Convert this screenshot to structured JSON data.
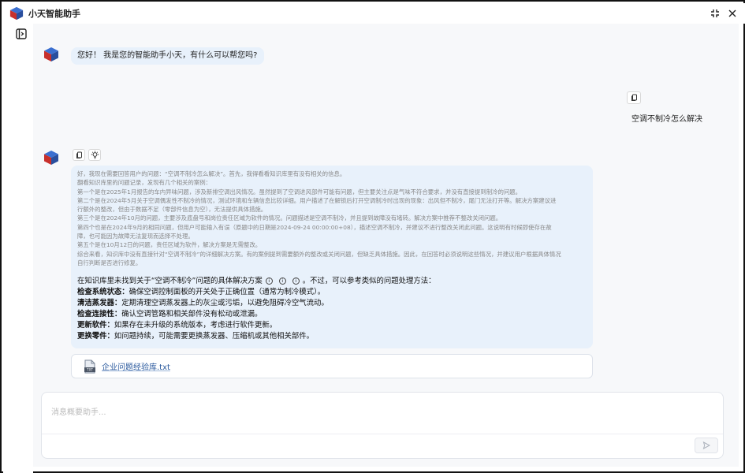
{
  "app": {
    "title": "小天智能助手"
  },
  "chat": {
    "greeting": "您好！ 我是您的智能助手小天，有什么可以帮您吗?",
    "user_message": "空调不制冷怎么解决",
    "thinking": [
      "好，我现在需要回答用户的问题：“空调不制冷怎么解决”。首先，我得看看知识库里有没有相关的信息。",
      "翻看知识库里的问题记录，发现有几个相关的案例：",
      "第一个是在2025年1月报告的车内异味问题，涉及新排空调出风情况。虽然提到了空调进风部件可能有问题，但主要关注点是气味不符合要求，并没有直接提到制冷的问题。",
      "第二个是在2024年5月关于空调偶发性不制冷的情况，测试环境和车辆信息比较详细。用户描述了在解锁后打开空调制冷时出现的现象：出风但不制冷，尾门无法打开等。解决方案建议进",
      "行额外的整改，但由于数据不足（零部件信息为空），无法提供具体措施。",
      "第三个是在2024年10月的问题，主要涉及底盘号和岗位责任区域为软件的情况。问题描述是空调不制冷，并且提到故障没有堵转。解决方案中推荐不整改关闭问题。",
      "第四个也是在2024年9月的相同问题，但用户可能输入有误（原题中的日期是2024-09-24 00:00:00+08），描述空调不制冷，并建议不进行整改关闭此问题。这说明有时候即使存在故",
      "障，也可能因为故障无法复现而选择不处理。",
      "第五个是在10月12日的问题，责任区域为软件，解决方案是无需整改。",
      "综合来看，知识库中没有直接针对“空调不制冷”的详细解决方案。有的案例提到需要额外的整改或关闭问题，但缺乏具体措施。因此，在回答时必须说明这些情况，并建议用户根据具体情况",
      "自行判断是否进行修复。"
    ],
    "answer_intro": "在知识库里未找到关于“空调不制冷”问题的具体解决方案",
    "answer_intro_tail": "。不过，可以参考类似的问题处理方法：",
    "steps": [
      {
        "label": "检查系统状态：",
        "text": "确保空调控制面板的开关处于正确位置（通常为制冷模式）。"
      },
      {
        "label": "清洁蒸发器：",
        "text": "定期清理空调蒸发器上的灰尘或污垢，以避免阻碍冷空气流动。"
      },
      {
        "label": "检查连接性：",
        "text": "确认空调管路和相关部件没有松动或泄漏。"
      },
      {
        "label": "更新软件：",
        "text": "如果存在未升级的系统版本，考虑进行软件更新。"
      },
      {
        "label": "更换零件：",
        "text": "如问题持续，可能需要更换蒸发器、压缩机或其他相关部件。"
      }
    ],
    "attachment": {
      "name": "企业问题经验库.txt",
      "type_label": "TXT"
    }
  },
  "composer": {
    "placeholder": "消息概要助手..."
  }
}
